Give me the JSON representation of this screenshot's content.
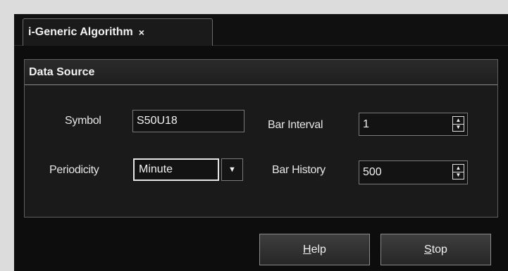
{
  "tab": {
    "title": "i-Generic Algorithm",
    "close_glyph": "×"
  },
  "panel": {
    "title": "Data Source"
  },
  "fields": {
    "symbol_label": "Symbol",
    "symbol_value": "S50U18",
    "periodicity_label": "Periodicity",
    "periodicity_value": "Minute",
    "bar_interval_label": "Bar Interval",
    "bar_interval_value": "1",
    "bar_history_label": "Bar History",
    "bar_history_value": "500"
  },
  "buttons": {
    "help_mnemonic": "H",
    "help_rest": "elp",
    "stop_mnemonic": "S",
    "stop_rest": "top"
  },
  "icons": {
    "spin_up": "▲",
    "spin_down": "▼",
    "dropdown": "▼"
  },
  "colors": {
    "background": "#0d0d0d",
    "panel": "#1a1a1a",
    "text": "#f2f2f2",
    "page_bg": "#dcdcdc"
  }
}
